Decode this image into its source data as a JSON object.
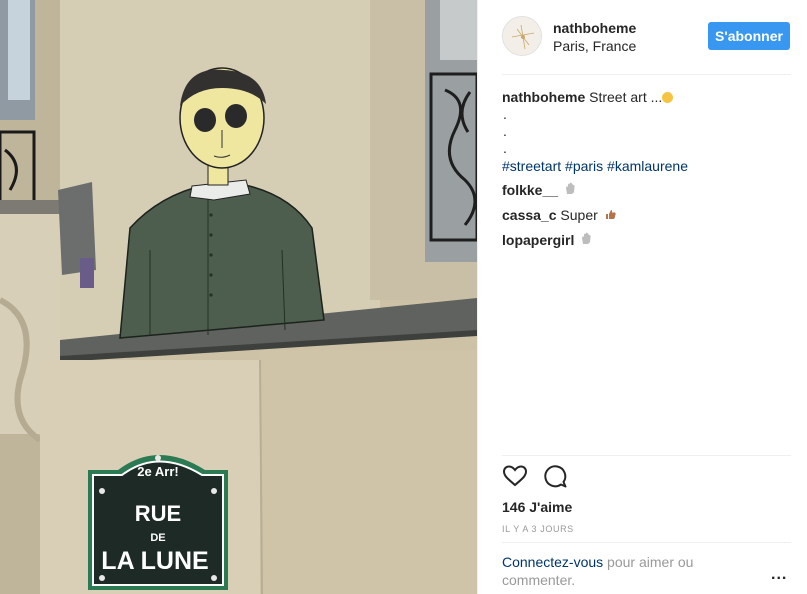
{
  "post": {
    "username": "nathboheme",
    "location": "Paris, France",
    "follow_label": "S'abonner",
    "caption": {
      "username": "nathboheme",
      "text": "Street art ...",
      "dots": [
        ".",
        ".",
        "."
      ],
      "hashtags": "#streetart #paris #kamlaurene"
    },
    "comments": [
      {
        "username": "folkke__",
        "text": "",
        "emoji": "hand-icon"
      },
      {
        "username": "cassa_c",
        "text": "Super",
        "emoji": "thumbs-up-icon"
      },
      {
        "username": "lopapergirl",
        "text": "",
        "emoji": "hand-icon"
      }
    ],
    "likes": "146 J'aime",
    "time": "IL Y A 3 JOURS",
    "login": {
      "link": "Connectez-vous",
      "text": " pour aimer ou commenter."
    },
    "more": "..."
  },
  "photo": {
    "sign": {
      "arrondissement": "2e Arr!",
      "line1": "RUE",
      "line2": "DE",
      "line3": "LA LUNE"
    }
  },
  "colors": {
    "accent": "#3897f0",
    "link": "#003569",
    "muted": "#999999"
  }
}
